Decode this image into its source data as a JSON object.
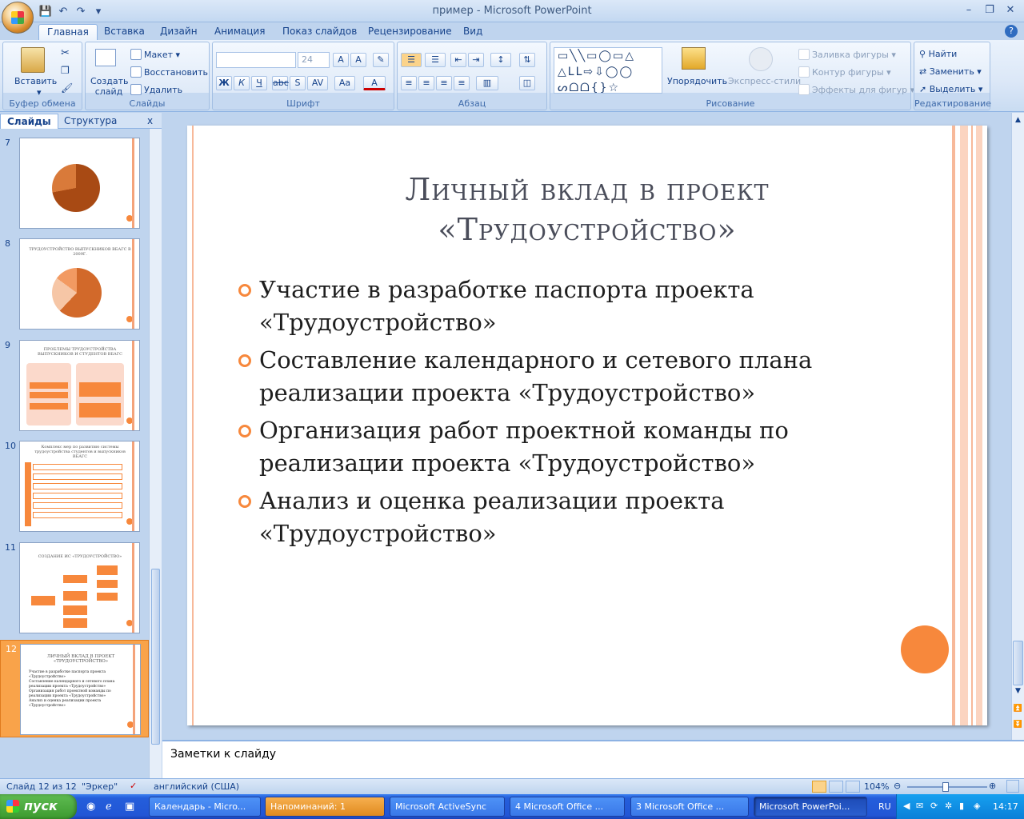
{
  "window": {
    "title": "пример - Microsoft PowerPoint"
  },
  "qat": {
    "save": "💾",
    "undo": "↶",
    "redo": "↷",
    "more": "▾"
  },
  "tabs": [
    {
      "label": "Главная",
      "active": true
    },
    {
      "label": "Вставка"
    },
    {
      "label": "Дизайн"
    },
    {
      "label": "Анимация"
    },
    {
      "label": "Показ слайдов"
    },
    {
      "label": "Рецензирование"
    },
    {
      "label": "Вид"
    }
  ],
  "ribbon": {
    "clipboard": {
      "label": "Буфер обмена",
      "paste": "Вставить"
    },
    "slides": {
      "label": "Слайды",
      "new_slide": "Создать слайд",
      "layout": "Макет",
      "reset": "Восстановить",
      "delete": "Удалить"
    },
    "font": {
      "label": "Шрифт",
      "size": "24"
    },
    "paragraph": {
      "label": "Абзац"
    },
    "drawing": {
      "label": "Рисование",
      "arrange": "Упорядочить",
      "quick_styles": "Экспресс-стили",
      "fill": "Заливка фигуры",
      "outline": "Контур фигуры",
      "effects": "Эффекты для фигур"
    },
    "editing": {
      "label": "Редактирование",
      "find": "Найти",
      "replace": "Заменить",
      "select": "Выделить"
    }
  },
  "left_pane": {
    "tabs": [
      "Слайды",
      "Структура"
    ],
    "close": "x",
    "thumbnails": [
      {
        "num": "7"
      },
      {
        "num": "8",
        "title": "ТРУДОУСТРОЙСТВО ВЫПУСКНИКОВ ВБАГС В 2009Г."
      },
      {
        "num": "9",
        "title": "ПРОБЛЕМЫ ТРУДОУСТРОЙСТВА ВЫПУСКНИКОВ И СТУДЕНТОВ ВБАГС"
      },
      {
        "num": "10",
        "title": "Комплекс мер по развитию системы трудоустройства студентов и выпускников ВБАГС"
      },
      {
        "num": "11",
        "title": "СОЗДАНИЕ ИС «ТРУДОУСТРОЙСТВО»"
      },
      {
        "num": "12",
        "title": "ЛИЧНЫЙ ВКЛАД В ПРОЕКТ «ТРУДОУСТРОЙСТВО»",
        "selected": true
      }
    ]
  },
  "slide": {
    "title": "Личный вклад в проект «Трудоустройство»",
    "bullets": [
      "Участие в разработке паспорта проекта «Трудоустройство»",
      "Составление календарного и сетевого плана реализации проекта «Трудоустройство»",
      "Организация работ проектной команды по реализации проекта «Трудоустройство»",
      "Анализ и оценка реализации проекта «Трудоустройство»"
    ],
    "accent": "#f7883c"
  },
  "notes": {
    "placeholder": "Заметки к слайду"
  },
  "status": {
    "slide": "Слайд 12 из 12",
    "theme": "\"Эркер\"",
    "language": "английский (США)",
    "zoom": "104%"
  },
  "taskbar": {
    "start": "пуск",
    "tasks": [
      "Календарь - Micro...",
      "Напоминаний: 1",
      "Microsoft ActiveSync",
      "4 Microsoft Office ...",
      "3 Microsoft Office ...",
      "Microsoft PowerPoi..."
    ],
    "lang": "RU",
    "clock": "14:17"
  }
}
